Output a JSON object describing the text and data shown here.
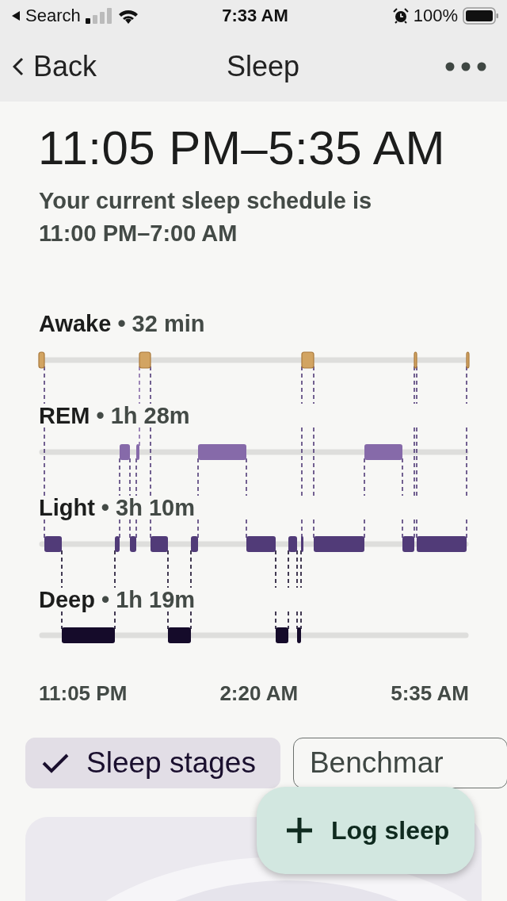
{
  "status_bar": {
    "back_app": "Search",
    "time": "7:33 AM",
    "battery": "100%"
  },
  "nav": {
    "back": "Back",
    "title": "Sleep"
  },
  "sleep_range": "11:05 PM–5:35 AM",
  "schedule": "Your current sleep schedule is\n11:00 PM–7:00 AM",
  "stages": [
    {
      "name": "Awake",
      "duration": "• 32 min",
      "color": "#d2a462"
    },
    {
      "name": "REM",
      "duration": "• 1h 28m",
      "color": "#866aa9"
    },
    {
      "name": "Light",
      "duration": "• 3h 10m",
      "color": "#513b78"
    },
    {
      "name": "Deep",
      "duration": "• 1h 19m",
      "color": "#150b2a"
    }
  ],
  "x_labels": [
    "11:05 PM",
    "2:20 AM",
    "5:35 AM"
  ],
  "chips": [
    {
      "label": "Sleep stages",
      "selected": true
    },
    {
      "label": "Benchmar",
      "selected": false
    }
  ],
  "fab": {
    "label": "Log sleep"
  }
}
